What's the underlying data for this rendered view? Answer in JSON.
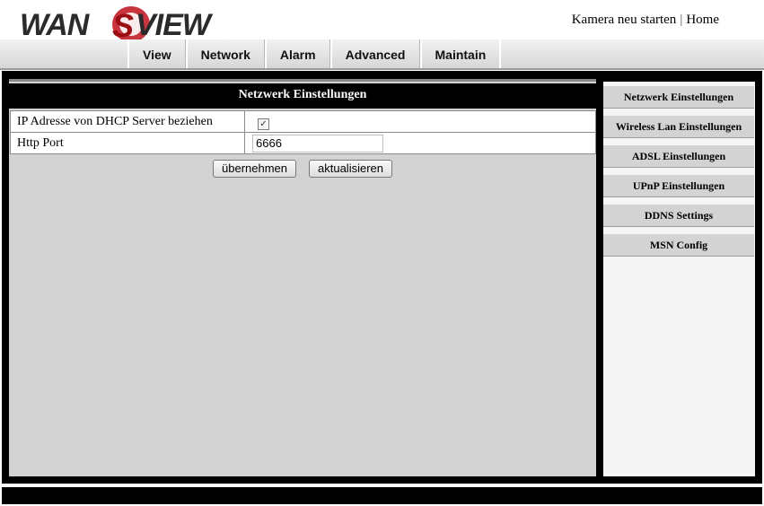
{
  "header": {
    "logo_text": "WANSVIEW",
    "links": [
      "Kamera neu starten",
      "Home"
    ],
    "separator": "|"
  },
  "nav": {
    "tabs": [
      "View",
      "Network",
      "Alarm",
      "Advanced",
      "Maintain"
    ]
  },
  "panel": {
    "title": "Netzwerk Einstellungen",
    "rows": [
      {
        "label": "IP Adresse von DHCP Server beziehen",
        "checked": true
      },
      {
        "label": "Http Port",
        "value": "6666"
      }
    ],
    "buttons": [
      "übernehmen",
      "aktualisieren"
    ]
  },
  "sidebar": {
    "items": [
      "Netzwerk Einstellungen",
      "Wireless Lan Einstellungen",
      "ADSL Einstellungen",
      "UPnP Einstellungen",
      "DDNS Settings",
      "MSN Config"
    ]
  },
  "colors": {
    "logo_dark": "#2b2b2b",
    "logo_red": "#c0121a",
    "content_bg": "#d3d3d3",
    "frame": "#000000"
  }
}
